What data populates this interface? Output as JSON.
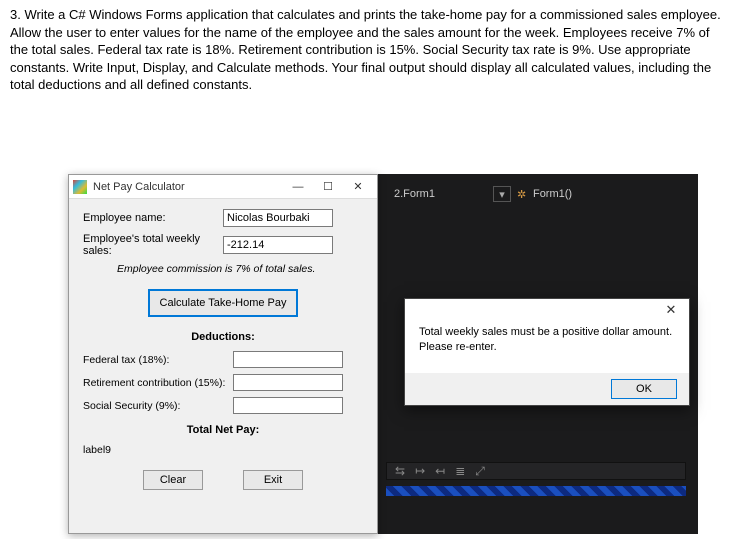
{
  "problem_text": "3. Write a C# Windows Forms application that calculates and prints the take-home pay for a commissioned sales employee. Allow the user to enter values for the name of the employee and the sales amount for the week. Employees receive 7% of the total sales. Federal tax rate is 18%. Retirement contribution is 15%. Social Security tax rate is 9%. Use appropriate constants. Write Input, Display, and Calculate methods. Your final output should display all calculated values, including the total deductions and all defined constants.",
  "calculator": {
    "window_title": "Net Pay Calculator",
    "emp_name_label": "Employee name:",
    "emp_name_value": "Nicolas Bourbaki",
    "emp_sales_label": "Employee's total weekly sales:",
    "emp_sales_value": "-212.14",
    "hint": "Employee commission is 7% of total sales.",
    "calc_button": "Calculate Take-Home Pay",
    "deductions_title": "Deductions:",
    "fed_tax_label": "Federal tax (18%):",
    "retire_label": "Retirement contribution (15%):",
    "ss_label": "Social Security (9%):",
    "netpay_label": "Total Net Pay:",
    "label9": "label9",
    "clear_button": "Clear",
    "exit_button": "Exit",
    "titlebar": {
      "min": "—",
      "max": "☐",
      "close": "✕"
    }
  },
  "ide": {
    "tab": "2.Form1",
    "combo_caret": "▾",
    "form10": "Form1()"
  },
  "msgbox": {
    "line1": "Total weekly sales must be a positive dollar amount.",
    "line2": "Please re-enter.",
    "ok": "OK",
    "close": "✕"
  },
  "toolbar_icons": [
    "⇆",
    "↦",
    "↤",
    "≣",
    "⤢"
  ]
}
